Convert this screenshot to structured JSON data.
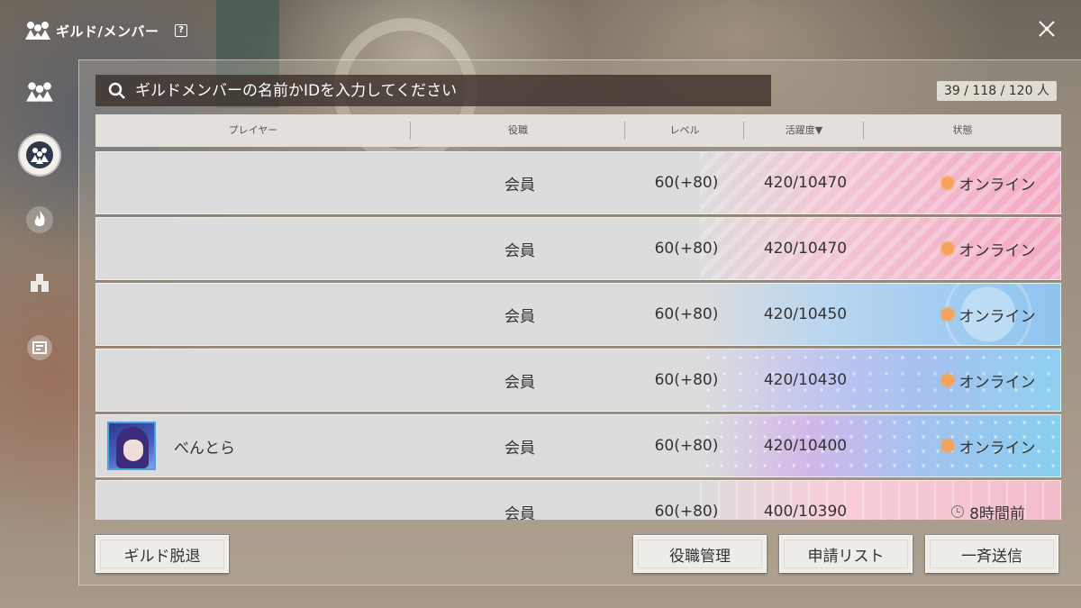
{
  "header": {
    "title": "ギルド/メンバー",
    "help_label": "?"
  },
  "search": {
    "placeholder": "ギルドメンバーの名前かIDを入力してください"
  },
  "member_count": "39 / 118 / 120 人",
  "columns": {
    "player": "プレイヤー",
    "role": "役職",
    "level": "レベル",
    "activity": "活躍度▼",
    "status": "状態"
  },
  "members": [
    {
      "name": "",
      "role": "会員",
      "level": "60(+80)",
      "activity": "420/10470",
      "status": "オンライン",
      "status_icon": "sun-icon",
      "card_theme": "pink-stripes"
    },
    {
      "name": "",
      "role": "会員",
      "level": "60(+80)",
      "activity": "420/10470",
      "status": "オンライン",
      "status_icon": "sun-icon",
      "card_theme": "pink-stripes"
    },
    {
      "name": "",
      "role": "会員",
      "level": "60(+80)",
      "activity": "420/10450",
      "status": "オンライン",
      "status_icon": "sun-icon",
      "card_theme": "blue-rings"
    },
    {
      "name": "",
      "role": "会員",
      "level": "60(+80)",
      "activity": "420/10430",
      "status": "オンライン",
      "status_icon": "sun-icon",
      "card_theme": "blue-stars"
    },
    {
      "name": "べんとら",
      "role": "会員",
      "level": "60(+80)",
      "activity": "420/10400",
      "status": "オンライン",
      "status_icon": "sun-icon",
      "card_theme": "sky-stars",
      "has_avatar": true
    },
    {
      "name": "",
      "role": "会員",
      "level": "60(+80)",
      "activity": "400/10390",
      "status": "8時間前",
      "status_icon": "clock-icon",
      "card_theme": "pink-grid"
    }
  ],
  "buttons": {
    "leave": "ギルド脱退",
    "roles": "役職管理",
    "requests": "申請リスト",
    "broadcast": "一斉送信"
  },
  "sidebar": {
    "items": [
      "guild-members-icon",
      "group-icon",
      "flame-icon",
      "castle-icon",
      "badge-icon"
    ]
  },
  "colors": {
    "online": "#f5a35a",
    "search_bg": "#372d28",
    "card_bg": "#dcdcdc"
  }
}
